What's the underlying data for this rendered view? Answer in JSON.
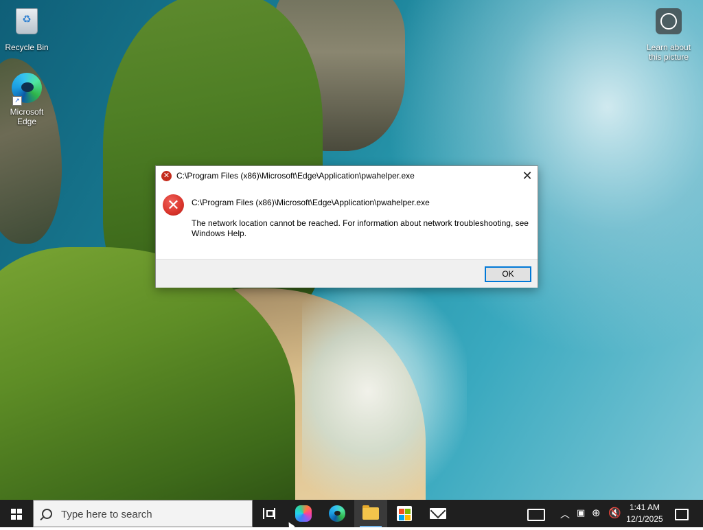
{
  "desktop": {
    "icons": [
      {
        "label": "Recycle Bin",
        "icon": "recycle-bin-icon"
      },
      {
        "label": "Microsoft Edge",
        "icon": "edge-icon"
      },
      {
        "label": "Learn about this picture",
        "icon": "camera-icon"
      }
    ]
  },
  "dialog": {
    "title": "C:\\Program Files (x86)\\Microsoft\\Edge\\Application\\pwahelper.exe",
    "path": "C:\\Program Files (x86)\\Microsoft\\Edge\\Application\\pwahelper.exe",
    "message": "The network location cannot be reached. For information about network troubleshooting, see Windows Help.",
    "ok_label": "OK",
    "close_glyph": "✕",
    "error_icon": "error-icon"
  },
  "taskbar": {
    "search_placeholder": "Type here to search",
    "apps": [
      "task-view-icon",
      "copilot-icon",
      "edge-icon",
      "file-explorer-icon",
      "microsoft-store-icon",
      "mail-icon"
    ],
    "active_app": "file-explorer-icon",
    "time": "1:41 AM",
    "date": "12/1/2025",
    "tray_icons": [
      "news-icon",
      "chevron-up-icon",
      "meet-now-icon",
      "network-icon",
      "volume-muted-icon",
      "notification-icon"
    ],
    "accent_color": "#76b9ed"
  }
}
